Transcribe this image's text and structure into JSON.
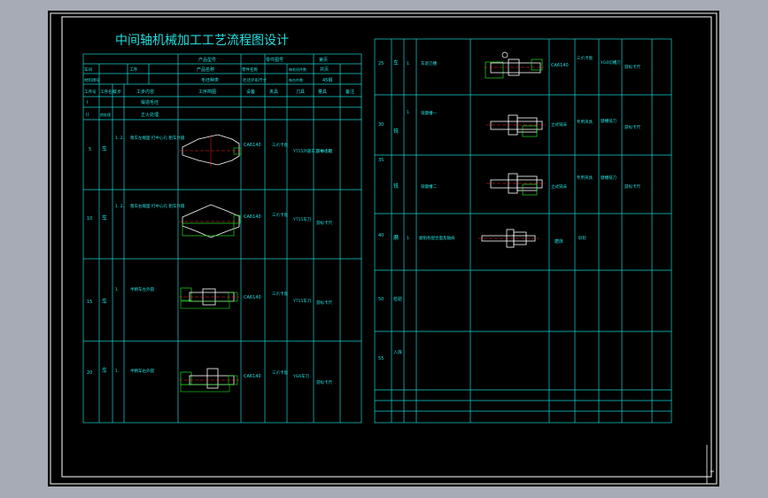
{
  "title": "中间轴机械加工工艺流程图设计",
  "colors": {
    "background": "#000000",
    "frame": "#ffffff",
    "grid": "#19d3d3",
    "text": "#24e0e0",
    "part": "#ffffff",
    "fixture": "#22dd22",
    "centerline": "#ff2222"
  },
  "left_table": {
    "header": {
      "product_model_label": "产品型号",
      "part_no_label": "零件图号",
      "sheet_label": "第页",
      "product_name_label": "产品名称",
      "part_name_label": "零件名称",
      "total_sheet_label": "共页",
      "workshop_label": "车间",
      "process_label": "工序",
      "material_label": "材料牌号",
      "material_value": "45钢",
      "blank_type_label": "毛坯种类",
      "blank_size_label": "毛坯外形尺寸",
      "per_blank_label": "每毛坯件数",
      "per_unit_label": "每台件数"
    },
    "columns": [
      "工序号",
      "工序名称",
      "工步",
      "工步内容",
      "工序简图",
      "设备",
      "夹具",
      "刀具",
      "量具",
      "备注"
    ],
    "rows": [
      {
        "no": "I",
        "name": "",
        "step": "",
        "content": "锻造毛坯",
        "equip": "",
        "fixture": "",
        "tool": "",
        "gauge": ""
      },
      {
        "no": "II",
        "name": "热处理",
        "step": "",
        "content": "正火处理",
        "equip": "",
        "fixture": "",
        "tool": "",
        "gauge": ""
      },
      {
        "no": "5",
        "name": "车",
        "step": "1. 2.",
        "content": "粗车左端面 打中心孔 粗车外圆",
        "equip": "CA6140",
        "fixture": "三爪卡盘",
        "tool": "YT15外圆车刀 中心钻",
        "gauge": "游标卡尺"
      },
      {
        "no": "10",
        "name": "车",
        "step": "1. 2.",
        "content": "粗车右端面 打中心孔 粗车外圆",
        "equip": "CA6140",
        "fixture": "三爪卡盘",
        "tool": "YT15车刀",
        "gauge": "游标卡尺"
      },
      {
        "no": "15",
        "name": "车",
        "step": "1.",
        "content": "半精车左外圆",
        "equip": "CA6140",
        "fixture": "三爪卡盘",
        "tool": "YT15车刀",
        "gauge": "游标卡尺"
      },
      {
        "no": "20",
        "name": "车",
        "step": "1.",
        "content": "半精车右外圆",
        "equip": "CA6140",
        "fixture": "三爪卡盘",
        "tool": "YG6车刀",
        "gauge": "游标卡尺"
      }
    ]
  },
  "right_table": {
    "rows": [
      {
        "no": "25",
        "name": "车",
        "step": "1.",
        "content": "车退刀槽",
        "equip": "CA6140",
        "fixture": "三爪卡盘",
        "tool": "YG6切槽刀",
        "gauge": "游标卡尺"
      },
      {
        "no": "30",
        "name": "铣",
        "step": "1.",
        "content": "铣键槽一",
        "equip": "立式铣床",
        "fixture": "专用夹具",
        "tool": "键槽铣刀",
        "gauge": "游标卡尺"
      },
      {
        "no": "35",
        "name": "铣",
        "step": "",
        "content": "铣键槽二",
        "equip": "立式铣床",
        "fixture": "专用夹具",
        "tool": "键槽铣刀",
        "gauge": "游标卡尺"
      },
      {
        "no": "40",
        "name": "磨",
        "step": "1.",
        "content": "磨削各配合面及轴肩",
        "equip": "磨床",
        "fixture": "",
        "tool": "砂轮",
        "gauge": ""
      },
      {
        "no": "50",
        "name": "检验",
        "step": "",
        "content": "",
        "equip": "",
        "fixture": "",
        "tool": "",
        "gauge": ""
      },
      {
        "no": "55",
        "name": "入库",
        "step": "",
        "content": "",
        "equip": "",
        "fixture": "",
        "tool": "",
        "gauge": ""
      }
    ]
  }
}
